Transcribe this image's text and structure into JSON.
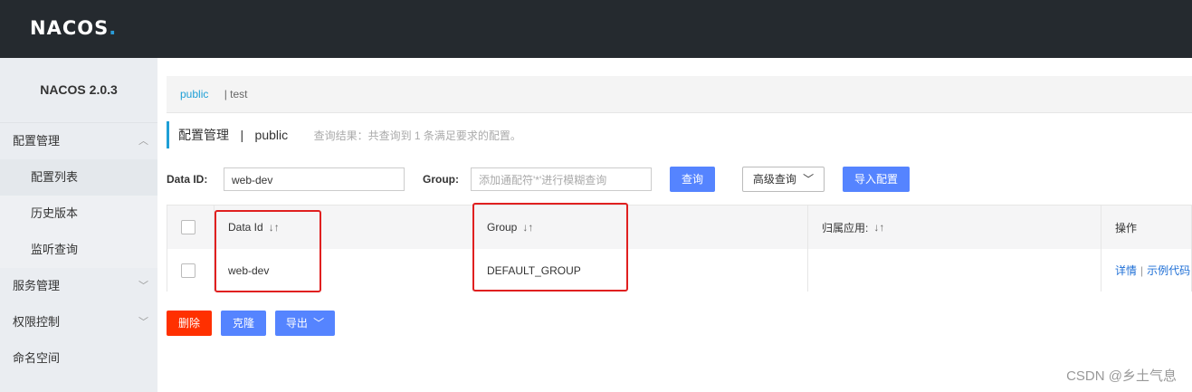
{
  "app": {
    "logo_main": "NACOS",
    "logo_dot": "."
  },
  "sidebar": {
    "version": "NACOS 2.0.3",
    "items": [
      {
        "label": "配置管理",
        "chevron": "^"
      },
      {
        "label": "配置列表"
      },
      {
        "label": "历史版本"
      },
      {
        "label": "监听查询"
      },
      {
        "label": "服务管理",
        "chevron": "v"
      },
      {
        "label": "权限控制",
        "chevron": "v"
      },
      {
        "label": "命名空间"
      }
    ]
  },
  "namespaces": {
    "active": "public",
    "separator": "|",
    "other": "test"
  },
  "header": {
    "title": "配置管理",
    "separator": "|",
    "namespace": "public",
    "result_hint": "查询结果：共查询到 1 条满足要求的配置。"
  },
  "filters": {
    "data_id_label": "Data ID:",
    "data_id_value": "web-dev",
    "group_label": "Group:",
    "group_placeholder": "添加通配符'*'进行模糊查询",
    "query_button": "查询",
    "advanced_button": "高级查询",
    "import_button": "导入配置"
  },
  "table": {
    "columns": [
      "Data Id",
      "Group",
      "归属应用:",
      "操作"
    ],
    "sort_icon": "↓↑",
    "rows": [
      {
        "data_id": "web-dev",
        "group": "DEFAULT_GROUP",
        "app": "",
        "actions": [
          "详情",
          "示例代码"
        ]
      }
    ]
  },
  "bulk_actions": {
    "delete": "删除",
    "clone": "克隆",
    "export": "导出"
  },
  "watermark": "CSDN @乡土气息",
  "colors": {
    "topbar": "#252a2f",
    "accent": "#1e9fd6",
    "primary": "#5584ff",
    "danger": "#ff3000",
    "highlight": "#e02020"
  }
}
